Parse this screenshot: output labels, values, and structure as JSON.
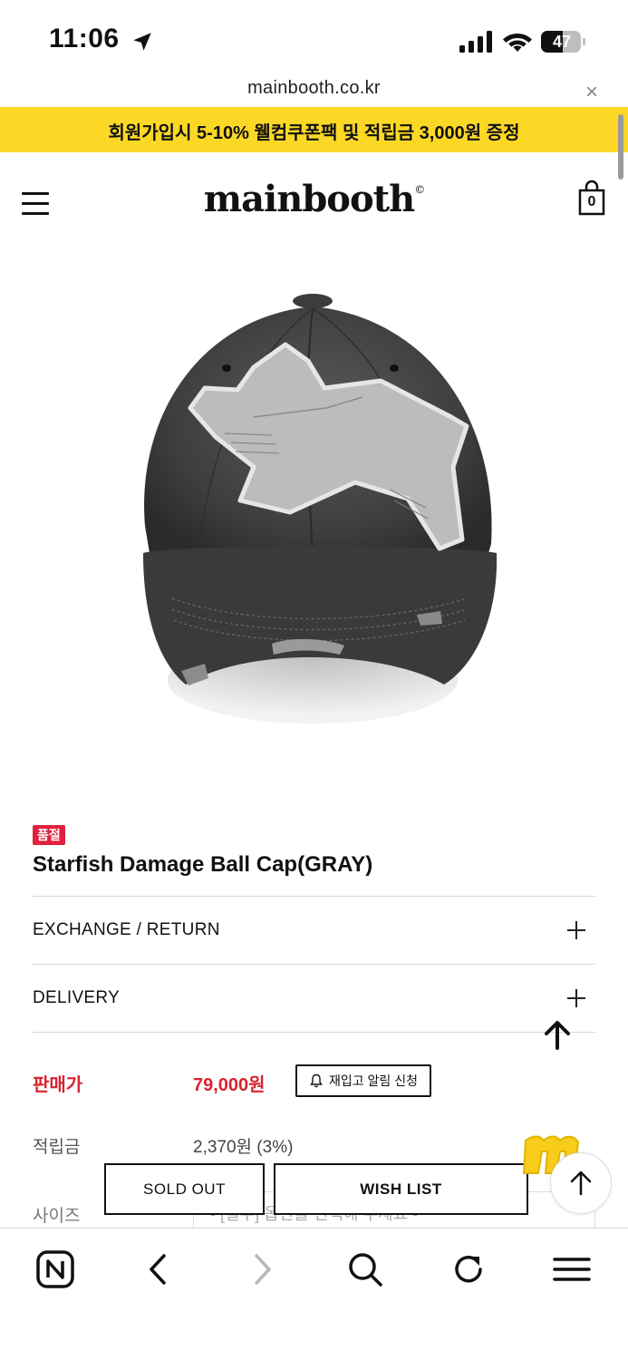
{
  "status_bar": {
    "time": "11:06",
    "battery": "47",
    "icons": [
      "location-arrow-icon",
      "cellular-signal-icon",
      "wifi-icon",
      "battery-icon"
    ]
  },
  "url_bar": {
    "url": "mainbooth.co.kr",
    "close_symbol": "×"
  },
  "promo_banner": {
    "text": "회원가입시 5-10% 웰컴쿠폰팩 및 적립금 3,000원 증정",
    "color": "#fcd826"
  },
  "header": {
    "logo": "mainbooth",
    "logo_mark": "©",
    "cart_count": "0",
    "icons": [
      "menu-icon",
      "shopping-bag-icon"
    ]
  },
  "product": {
    "image": "gray-distressed-ball-cap-with-star-patch",
    "badge": "품절",
    "name": "Starfish Damage Ball Cap(GRAY)",
    "accordions": [
      {
        "label": "EXCHANGE / RETURN",
        "icon": "plus-icon"
      },
      {
        "label": "DELIVERY",
        "icon": "plus-icon"
      }
    ],
    "price_label": "판매가",
    "price": "79,000원",
    "restock_button": "재입고 알림 신청",
    "points_label": "적립금",
    "points_value": "2,370원 (3%)",
    "size_label": "사이즈",
    "size_placeholder": "- [필수] 옵션을 선택해 주세요 -"
  },
  "actions": {
    "sold_out": "SOLD OUT",
    "wish_list": "WISH LIST"
  },
  "colors": {
    "accent_red": "#d9232e",
    "badge_red": "#e0203d",
    "banner_yellow": "#fcd826"
  },
  "toolbar": {
    "items": [
      "naver-home-icon",
      "back-icon",
      "forward-icon",
      "search-icon",
      "reload-icon",
      "menu-icon"
    ]
  }
}
